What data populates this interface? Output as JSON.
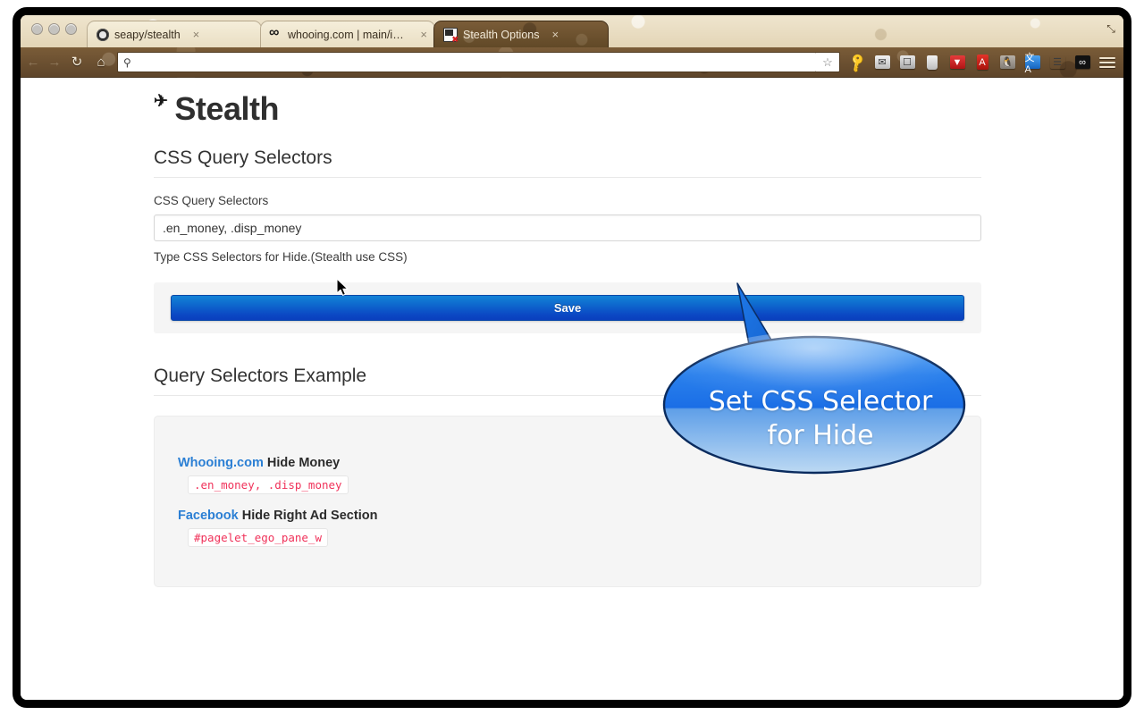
{
  "browser": {
    "window_controls": [
      "close",
      "minimize",
      "zoom"
    ],
    "tabs": [
      {
        "title": "seapy/stealth",
        "favicon": "github-icon",
        "active": false,
        "close_label": "×"
      },
      {
        "title": "whooing.com | main/insert",
        "favicon": "whooing-icon",
        "active": false,
        "close_label": "×"
      },
      {
        "title": "Stealth Options",
        "favicon": "stealth-monitor-icon",
        "active": true,
        "close_label": "×"
      }
    ],
    "toolbar": {
      "back_glyph": "←",
      "forward_glyph": "→",
      "reload_glyph": "↻",
      "home_glyph": "⌂",
      "search_glyph": "⚲",
      "url_value": "",
      "url_placeholder": "",
      "bookmark_star_glyph": "☆",
      "extensions": [
        {
          "name": "key-icon",
          "glyph": "⚿"
        },
        {
          "name": "mail-icon",
          "glyph": "✉"
        },
        {
          "name": "archive-icon",
          "glyph": "❐"
        },
        {
          "name": "trash-icon",
          "glyph": "⌧"
        },
        {
          "name": "pocket-icon",
          "glyph": "◆"
        },
        {
          "name": "dictionary-icon",
          "glyph": "▮"
        },
        {
          "name": "evernote-icon",
          "glyph": "◔"
        },
        {
          "name": "translate-icon",
          "glyph": "A"
        },
        {
          "name": "layers-icon",
          "glyph": "≡"
        },
        {
          "name": "owl-icon",
          "glyph": "∞"
        }
      ],
      "menu_glyph": "☰",
      "fullscreen_glyph": "⤡"
    }
  },
  "page": {
    "title": "Stealth",
    "title_icon": "✈",
    "sections": {
      "selectors": {
        "heading": "CSS Query Selectors",
        "field_label": "CSS Query Selectors",
        "input_value": ".en_money, .disp_money",
        "input_placeholder": "",
        "help_text": "Type CSS Selectors for Hide.(Stealth use CSS)",
        "save_label": "Save"
      },
      "examples": {
        "heading": "Query Selectors Example",
        "items": [
          {
            "site": "Whooing.com",
            "description": "Hide Money",
            "code": ".en_money, .disp_money"
          },
          {
            "site": "Facebook",
            "description": "Hide Right Ad Section",
            "code": "#pagelet_ego_pane_w"
          }
        ]
      }
    }
  },
  "callout": {
    "text": "Set CSS Selector\nfor Hide"
  },
  "colors": {
    "accent_blue": "#1478d8",
    "button_blue_top": "#1382d6",
    "button_blue_bottom": "#0a3fbe",
    "link_blue": "#2b7fd4",
    "code_red": "#f0325a",
    "panel_gray": "#f5f5f5",
    "chrome_dark": "#6a4f30",
    "chrome_light": "#e8dcc2"
  }
}
